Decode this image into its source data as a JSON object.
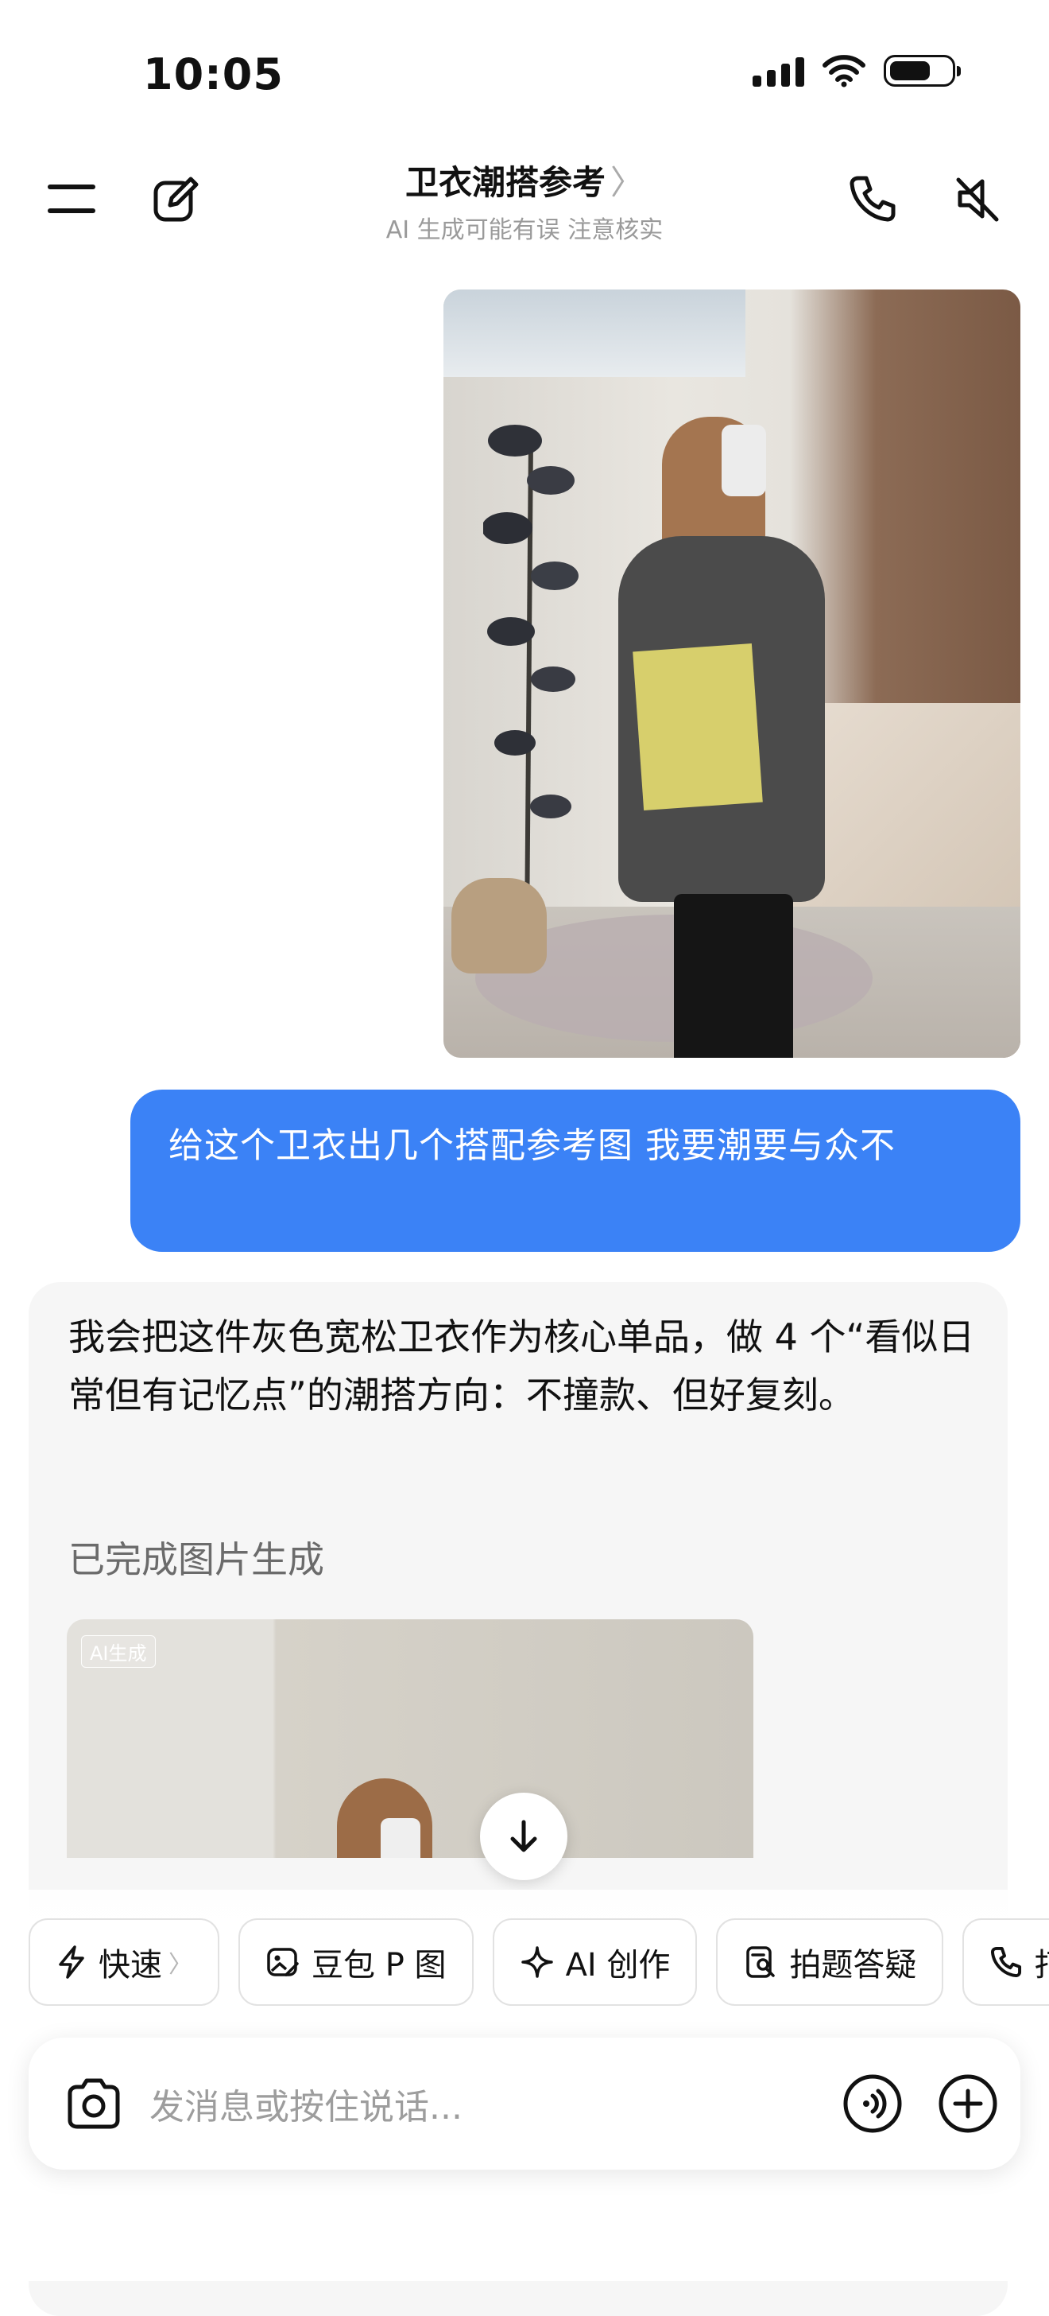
{
  "status_bar": {
    "time": "10:05"
  },
  "header": {
    "title": "卫衣潮搭参考",
    "title_chevron": "〉",
    "subtitle": "AI 生成可能有误 注意核实"
  },
  "messages": {
    "user_text": "给这个卫衣出几个搭配参考图 我要潮要与众不",
    "assistant_text": "我会把这件灰色宽松卫衣作为核心单品，做 4 个“看似日常但有记忆点”的潮搭方向：不撞款、但好复刻。",
    "assistant_status": "已完成图片生成",
    "ai_badge": "AI生成"
  },
  "chips": [
    {
      "label": "快速",
      "icon": "lightning-icon",
      "chevron": "〉"
    },
    {
      "label": "豆包 P 图",
      "icon": "image-edit-icon"
    },
    {
      "label": "AI 创作",
      "icon": "sparkle-icon"
    },
    {
      "label": "拍题答疑",
      "icon": "doc-search-icon"
    },
    {
      "label": "打",
      "icon": "phone-icon"
    }
  ],
  "input": {
    "placeholder": "发消息或按住说话..."
  },
  "colors": {
    "user_bubble": "#3b82f6",
    "assistant_card": "#f6f6f6"
  }
}
